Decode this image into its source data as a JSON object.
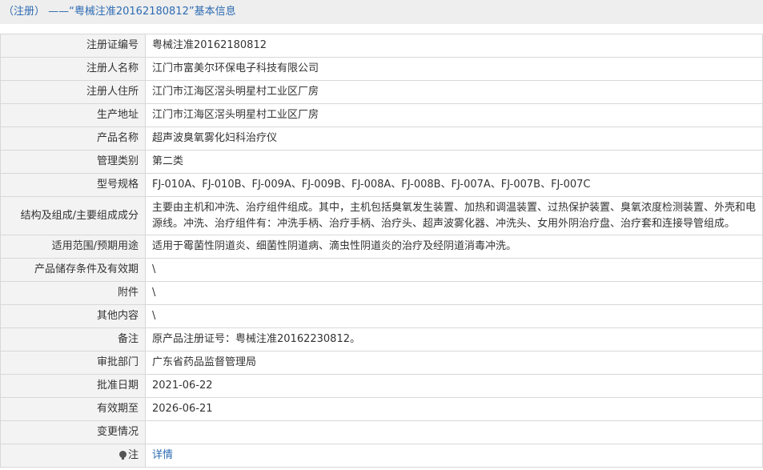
{
  "header": {
    "title": "（注册） ——“粤械注准20162180812”基本信息"
  },
  "rows": [
    {
      "label": "注册证编号",
      "value": "粤械注准20162180812"
    },
    {
      "label": "注册人名称",
      "value": "江门市富美尔环保电子科技有限公司"
    },
    {
      "label": "注册人住所",
      "value": "江门市江海区滘头明星村工业区厂房"
    },
    {
      "label": "生产地址",
      "value": "江门市江海区滘头明星村工业区厂房"
    },
    {
      "label": "产品名称",
      "value": "超声波臭氧雾化妇科治疗仪"
    },
    {
      "label": "管理类别",
      "value": "第二类"
    },
    {
      "label": "型号规格",
      "value": "FJ-010A、FJ-010B、FJ-009A、FJ-009B、FJ-008A、FJ-008B、FJ-007A、FJ-007B、FJ-007C"
    },
    {
      "label": "结构及组成/主要组成成分",
      "value": "主要由主机和冲洗、治疗组件组成。其中，主机包括臭氧发生装置、加热和调温装置、过热保护装置、臭氧浓度检测装置、外壳和电源线。冲洗、治疗组件有：冲洗手柄、治疗手柄、治疗头、超声波雾化器、冲洗头、女用外阴治疗盘、治疗套和连接导管组成。"
    },
    {
      "label": "适用范围/预期用途",
      "value": "适用于霉菌性阴道炎、细菌性阴道病、滴虫性阴道炎的治疗及经阴道消毒冲洗。"
    },
    {
      "label": "产品储存条件及有效期",
      "value": "\\"
    },
    {
      "label": "附件",
      "value": "\\"
    },
    {
      "label": "其他内容",
      "value": "\\"
    },
    {
      "label": "备注",
      "value": "原产品注册证号：粤械注准20162230812。"
    },
    {
      "label": "审批部门",
      "value": "广东省药品监督管理局"
    },
    {
      "label": "批准日期",
      "value": "2021-06-22"
    },
    {
      "label": "有效期至",
      "value": "2026-06-21"
    },
    {
      "label": "变更情况",
      "value": ""
    }
  ],
  "note": {
    "label": "注",
    "link_text": "详情",
    "icon": "lightbulb-icon"
  }
}
